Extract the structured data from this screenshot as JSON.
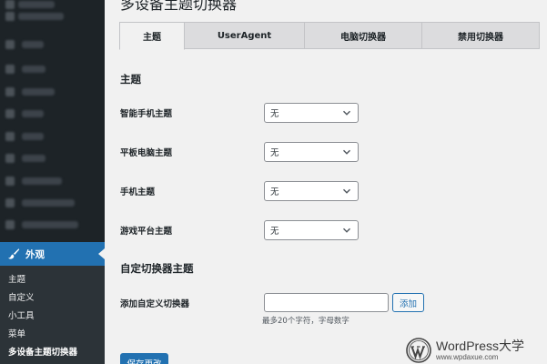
{
  "sidebar": {
    "appearance_label": "外观",
    "submenu": [
      {
        "label": "主题"
      },
      {
        "label": "自定义"
      },
      {
        "label": "小工具"
      },
      {
        "label": "菜单"
      },
      {
        "label": "多设备主题切换器"
      }
    ]
  },
  "page": {
    "title": "多设备主题切换器"
  },
  "tabs": [
    {
      "label": "主题"
    },
    {
      "label": "UserAgent"
    },
    {
      "label": "电脑切换器"
    },
    {
      "label": "禁用切换器"
    }
  ],
  "theme_section": {
    "title": "主题",
    "rows": [
      {
        "label": "智能手机主题",
        "value": "无"
      },
      {
        "label": "平板电脑主题",
        "value": "无"
      },
      {
        "label": "手机主题",
        "value": "无"
      },
      {
        "label": "游戏平台主题",
        "value": "无"
      }
    ]
  },
  "custom_section": {
    "title": "自定切换器主题",
    "label": "添加自定义切换器",
    "input_value": "",
    "add_label": "添加",
    "hint": "最多20个字符，字母数字"
  },
  "save_label": "保存更改",
  "watermark": {
    "title": "WordPress大学",
    "url": "www.wpdaxue.com"
  },
  "colors": {
    "accent": "#2271b1",
    "sidebar_bg": "#1d2327",
    "submenu_bg": "#2c3338",
    "page_bg": "#f1f1f1"
  }
}
